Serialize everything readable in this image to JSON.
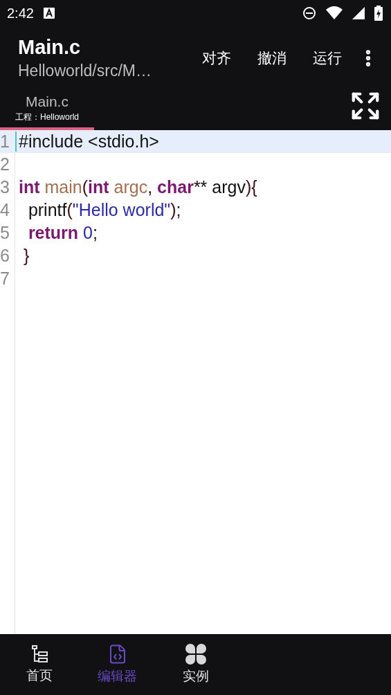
{
  "status_bar": {
    "time": "2:42"
  },
  "app_bar": {
    "title": "Main.c",
    "subtitle": "Helloworld/src/M…",
    "actions": [
      "对齐",
      "撤消",
      "运行"
    ]
  },
  "tabs": [
    {
      "label": "Main.c",
      "project": "工程：Helloworld",
      "selected": true
    }
  ],
  "editor": {
    "lines": [
      {
        "number": "1",
        "selected": true,
        "tokens": [
          {
            "kind": "plain",
            "text": "#include <stdio.h>"
          }
        ]
      },
      {
        "number": "2",
        "selected": false
      },
      {
        "number": "3",
        "selected": false,
        "tokens": [
          {
            "kind": "keyword",
            "text": "int"
          },
          {
            "kind": "ident",
            "text": " main"
          },
          {
            "kind": "punct",
            "text": "("
          },
          {
            "kind": "keyword",
            "text": "int"
          },
          {
            "kind": "ident",
            "text": " argc"
          },
          {
            "kind": "plain",
            "text": ","
          },
          {
            "kind": "keyword",
            "text": " char"
          },
          {
            "kind": "plain",
            "text": "** argv"
          },
          {
            "kind": "punct",
            "text": "){"
          }
        ]
      },
      {
        "number": "4",
        "selected": false,
        "tokens": [
          {
            "kind": "plain",
            "text": "  printf"
          },
          {
            "kind": "punct",
            "text": "("
          },
          {
            "kind": "string",
            "text": "\"Hello world\""
          },
          {
            "kind": "punct",
            "text": ");"
          }
        ]
      },
      {
        "number": "5",
        "selected": false,
        "tokens": [
          {
            "kind": "keyword",
            "text": "  return"
          },
          {
            "kind": "number",
            "text": " 0"
          },
          {
            "kind": "plain",
            "text": ";"
          }
        ]
      },
      {
        "number": "6",
        "selected": false,
        "tokens": [
          {
            "kind": "punct",
            "text": " }"
          }
        ]
      },
      {
        "number": "7",
        "selected": false
      }
    ]
  },
  "bottom_nav": [
    {
      "kind": "home",
      "label": "首页",
      "selected": false
    },
    {
      "kind": "editor",
      "label": "编辑器",
      "selected": true
    },
    {
      "kind": "examples",
      "label": "实例",
      "selected": false
    }
  ]
}
